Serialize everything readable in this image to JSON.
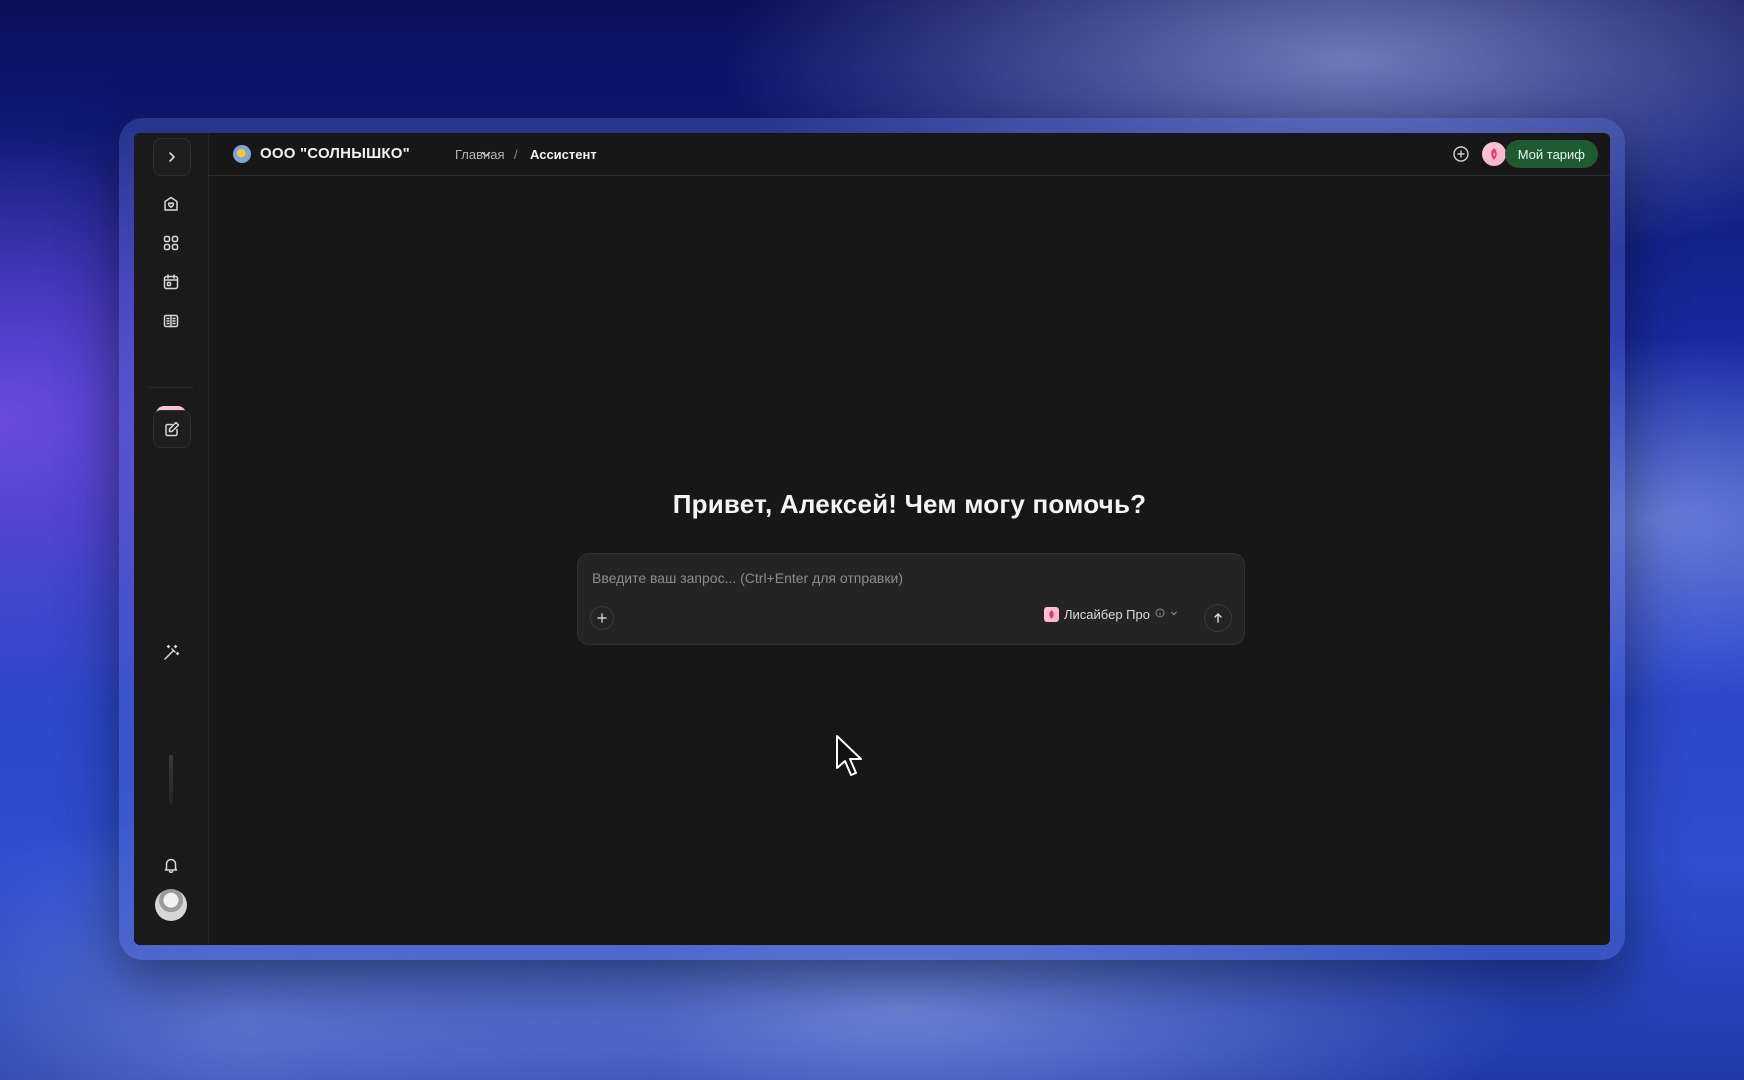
{
  "header": {
    "org_name": "ООО \"СОЛНЫШКО\"",
    "breadcrumb": {
      "home": "Главная",
      "separator": "/",
      "current": "Ассистент"
    },
    "plan_button": "Мой тариф"
  },
  "sidebar": {
    "icons": [
      "chevron-right-icon",
      "home-icon",
      "apps-grid-icon",
      "calendar-icon",
      "library-icon",
      "assistant-app-icon",
      "edit-icon",
      "magic-wand-icon",
      "bell-icon",
      "avatar"
    ]
  },
  "main": {
    "greeting": "Привет, Алексей! Чем могу помочь?",
    "composer": {
      "placeholder": "Введите ваш запрос... (Ctrl+Enter для отправки)",
      "model_name": "Лисайбер Про"
    }
  },
  "colors": {
    "window_bg": "#171717",
    "composer_bg": "#242424",
    "plan_button_bg": "#1f5a33",
    "app_accent_pink": "#f6b2c9",
    "app_accent_red": "#e5366a"
  }
}
